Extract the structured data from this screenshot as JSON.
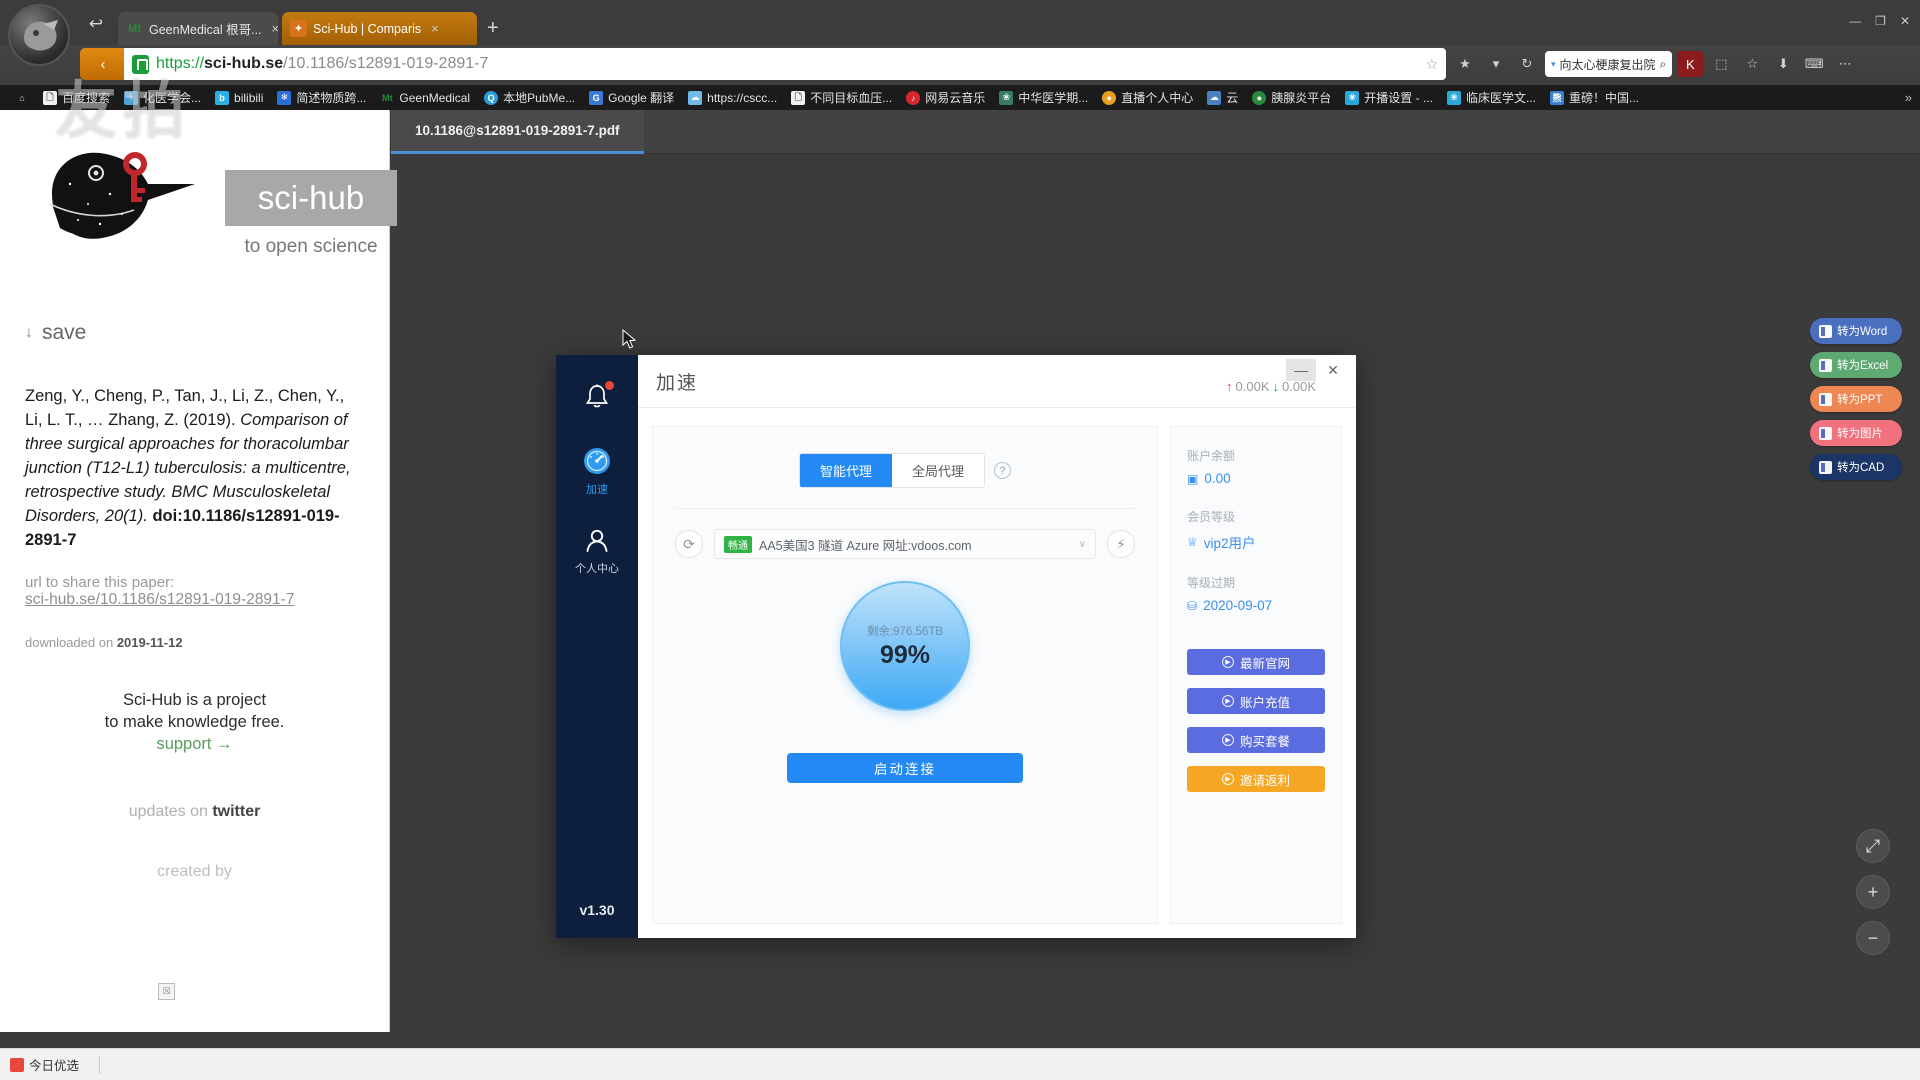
{
  "browser": {
    "tabs": [
      {
        "favicon_text": "Mt",
        "favicon_color": "#2a8a3c",
        "title": "GeenMedical 根哥...",
        "close": "×",
        "active": false
      },
      {
        "favicon_text": "✦",
        "favicon_color": "#e07b1a",
        "title": "Sci-Hub | Comparis",
        "close": "×",
        "active": true
      }
    ],
    "new_tab": "+",
    "back_arrow": "↩",
    "window_controls": [
      "—",
      "❐",
      "✕"
    ],
    "nav_back": "‹",
    "url": {
      "scheme": "https://",
      "host": "sci-hub.se",
      "path": "/10.1186/s12891-019-2891-7",
      "star": "☆"
    },
    "toolbar_icons": [
      "★",
      "▾",
      "↻"
    ],
    "search_pill": {
      "caret": "▾",
      "text": "向太心梗康复出院",
      "icon": "⌕"
    },
    "right_icons": [
      "K",
      "⬚",
      "☆",
      "⬇",
      "⌨",
      "⋯"
    ],
    "bookmarks": [
      {
        "icon": "⌂",
        "icon_color": "transparent",
        "label": ""
      },
      {
        "icon": "🗋",
        "icon_color": "#f0f0f0",
        "label": "百度搜索"
      },
      {
        "icon": "⚕",
        "icon_color": "#4da3d8",
        "label": "化医学会..."
      },
      {
        "icon": "b",
        "icon_color": "#2ab0e8",
        "label": "bilibili"
      },
      {
        "icon": "❄",
        "icon_color": "#2a6fd8",
        "label": "简述物质跨..."
      },
      {
        "icon": "Mt",
        "icon_color": "transparent",
        "label": "GeenMedical"
      },
      {
        "icon": "Q",
        "icon_color": "#2a9bd8",
        "label": "本地PubMe..."
      },
      {
        "icon": "G",
        "icon_color": "#3a79d8",
        "label": "Google 翻译"
      },
      {
        "icon": "☁",
        "icon_color": "#6fb8e8",
        "label": "https://cscc..."
      },
      {
        "icon": "🗋",
        "icon_color": "#f0f0f0",
        "label": "不同目标血压..."
      },
      {
        "icon": "♪",
        "icon_color": "#d8262c",
        "label": "网易云音乐"
      },
      {
        "icon": "❀",
        "icon_color": "#3a7a68",
        "label": "中华医学期..."
      },
      {
        "icon": "●",
        "icon_color": "#e8a020",
        "label": "直播个人中心"
      },
      {
        "icon": "☁",
        "icon_color": "#4a7fc0",
        "label": "云"
      },
      {
        "icon": "●",
        "icon_color": "#2a8a3c",
        "label": "胰腺炎平台"
      },
      {
        "icon": "❀",
        "icon_color": "#2aa8d8",
        "label": "开播设置 - ..."
      },
      {
        "icon": "❀",
        "icon_color": "#2aa8d8",
        "label": "临床医学文..."
      },
      {
        "icon": "熊",
        "icon_color": "#3a7fd0",
        "label": "重磅！中国..."
      }
    ],
    "bookmarks_overflow": "»",
    "watermark": "友拍"
  },
  "scihub": {
    "badge": "sci-hub",
    "tagline": "to open science",
    "save_label": "save",
    "save_arrow": "↓",
    "citation_authors": "Zeng, Y., Cheng, P., Tan, J., Li, Z., Chen, Y., Li, L. T., … Zhang, Z. (2019). ",
    "citation_title": "Comparison of three surgical approaches for thoracolumbar junction (T12-L1) tuberculosis: a multicentre, retrospective study. BMC Musculoskeletal Disorders, 20(1).",
    "citation_doi": " doi:10.1186/s12891-019-2891-7",
    "share_label": "url to share this paper:",
    "share_url": "sci-hub.se/10.1186/s12891-019-2891-7",
    "downloaded_prefix": "downloaded on ",
    "downloaded_date": "2019-11-12",
    "project_line1": "Sci-Hub is a project",
    "project_line2": "to make knowledge free.",
    "support": "support →",
    "updates_prefix": "updates on ",
    "updates_link": "twitter",
    "created_by": "created by",
    "broken_image": "☒"
  },
  "pdf_viewer": {
    "tab_title": "10.1186@s12891-019-2891-7.pdf",
    "convert_buttons": [
      {
        "label": "转为Word",
        "color": "#4a6fbf"
      },
      {
        "label": "转为Excel",
        "color": "#5faa72"
      },
      {
        "label": "转为PPT",
        "color": "#ef8754"
      },
      {
        "label": "转为图片",
        "color": "#f2717f"
      },
      {
        "label": "转为CAD",
        "color": "#1b3566"
      }
    ],
    "zoom_controls": [
      {
        "name": "fit-page",
        "glyph": "⤢"
      },
      {
        "name": "zoom-in",
        "glyph": "+"
      },
      {
        "name": "zoom-out",
        "glyph": "−"
      }
    ]
  },
  "vpn_dialog": {
    "title": "加速",
    "version": "v1.30",
    "speed_up": "0.00K",
    "speed_down": "0.00K",
    "speed_up_arrow": "↑",
    "speed_down_arrow": "↓",
    "minimize": "—",
    "close": "✕",
    "nav": [
      {
        "name": "notifications",
        "icon": "bell-icon",
        "label": "",
        "active": false,
        "badge": true
      },
      {
        "name": "accelerate",
        "icon": "gauge-icon",
        "label": "加速",
        "active": true,
        "badge": false
      },
      {
        "name": "user-center",
        "icon": "user-icon",
        "label": "个人中心",
        "active": false,
        "badge": false
      }
    ],
    "proxy_tabs": [
      {
        "label": "智能代理",
        "active": true
      },
      {
        "label": "全局代理",
        "active": false
      }
    ],
    "help_glyph": "?",
    "refresh_glyph": "⟳",
    "bolt_glyph": "⚡",
    "server": {
      "badge": "畅通",
      "name": "AA5美国3 隧道 Azure 网址:vdoos.com",
      "chevron": "∨"
    },
    "gauge": {
      "remaining": "剩余:976.56TB",
      "percent": "99%"
    },
    "connect_label": "启动连接",
    "account": [
      {
        "label": "账户余额",
        "icon": "▣",
        "value": "0.00"
      },
      {
        "label": "会员等级",
        "icon": "♕",
        "value": "vip2用户"
      },
      {
        "label": "等级过期",
        "icon": "⛁",
        "value": "2020-09-07"
      }
    ],
    "action_buttons": [
      {
        "label": "最新官网",
        "style": "blue"
      },
      {
        "label": "账户充值",
        "style": "blue"
      },
      {
        "label": "购买套餐",
        "style": "blue"
      },
      {
        "label": "邀请返利",
        "style": "orange"
      }
    ],
    "play_glyph": "▶"
  },
  "taskbar": {
    "item_label": "今日优选"
  }
}
